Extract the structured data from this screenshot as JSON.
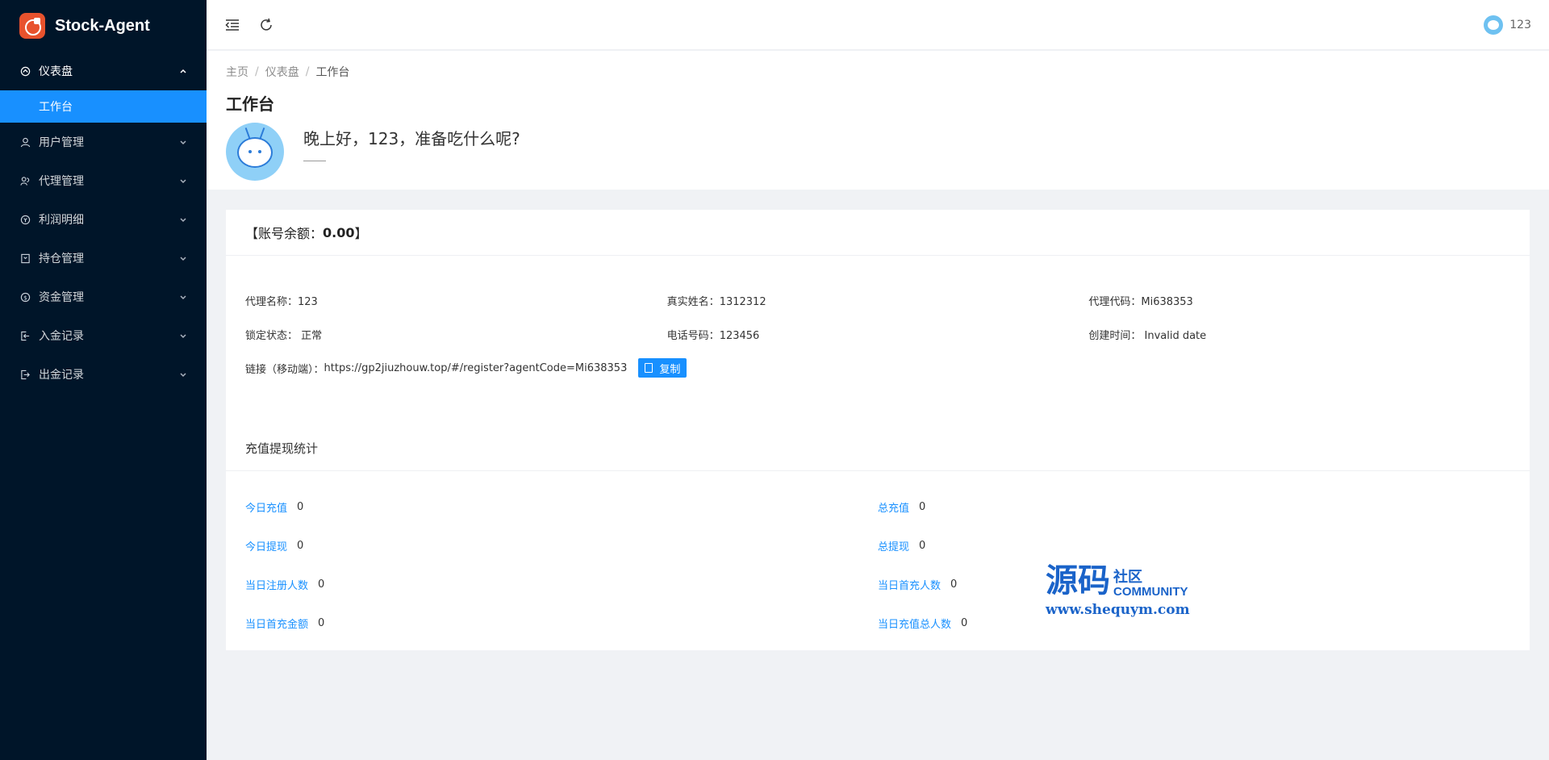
{
  "app": {
    "name": "Stock-Agent"
  },
  "sidebar": {
    "items": [
      {
        "label": "仪表盘",
        "icon": "dashboard-icon",
        "open": true
      },
      {
        "label": "用户管理",
        "icon": "user-icon"
      },
      {
        "label": "代理管理",
        "icon": "agents-icon"
      },
      {
        "label": "利润明细",
        "icon": "profit-icon"
      },
      {
        "label": "持仓管理",
        "icon": "position-icon"
      },
      {
        "label": "资金管理",
        "icon": "funds-icon"
      },
      {
        "label": "入金记录",
        "icon": "deposit-icon"
      },
      {
        "label": "出金记录",
        "icon": "withdraw-icon"
      }
    ],
    "active_sub": "工作台"
  },
  "header": {
    "username": "123"
  },
  "breadcrumb": {
    "home": "主页",
    "section": "仪表盘",
    "current": "工作台"
  },
  "page": {
    "title": "工作台",
    "greeting": "晚上好，123，准备吃什么呢?"
  },
  "account": {
    "balance_prefix": "【账号余额：",
    "balance": "0.00",
    "balance_suffix": "】"
  },
  "info": {
    "agent_name_label": "代理名称：",
    "agent_name": "123",
    "real_name_label": "真实姓名：",
    "real_name": "1312312",
    "agent_code_label": "代理代码：",
    "agent_code": "Mi638353",
    "lock_label": "锁定状态：",
    "lock": "正常",
    "phone_label": "电话号码：",
    "phone": "123456",
    "created_label": "创建时间：",
    "created": "Invalid date",
    "link_label": "链接（移动端）：",
    "link": "https://gp2jiuzhouw.top/#/register?agentCode=Mi638353",
    "copy_label": "复制"
  },
  "stats": {
    "title": "充值提现统计",
    "items": [
      {
        "label": "今日充值",
        "value": "0"
      },
      {
        "label": "总充值",
        "value": "0"
      },
      {
        "label": "今日提现",
        "value": "0"
      },
      {
        "label": "总提现",
        "value": "0"
      },
      {
        "label": "当日注册人数",
        "value": "0"
      },
      {
        "label": "当日首充人数",
        "value": "0"
      },
      {
        "label": "当日首充金额",
        "value": "0"
      },
      {
        "label": "当日充值总人数",
        "value": "0"
      }
    ]
  },
  "watermark": {
    "big": "源码",
    "small": "社区",
    "community": "COMMUNITY",
    "url": "www.shequym.com"
  },
  "colors": {
    "sidebar_bg": "#001529",
    "accent": "#1890ff",
    "page_bg": "#f0f2f5"
  }
}
